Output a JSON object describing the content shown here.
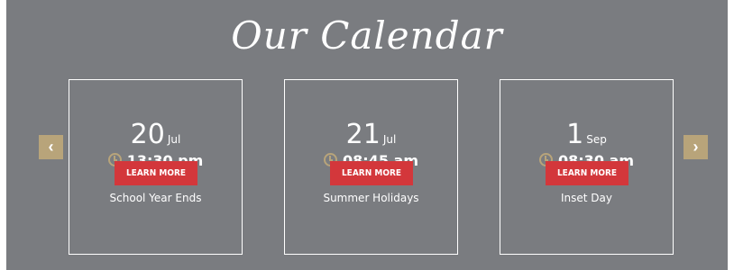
{
  "section": {
    "title": "Our Calendar"
  },
  "navigation": {
    "prev_icon": "chevron-left-icon",
    "next_icon": "chevron-right-icon",
    "prev_glyph": "‹",
    "next_glyph": "›"
  },
  "events": [
    {
      "day": "20",
      "month": "Jul",
      "time": "13:30 pm",
      "title": "School Year Ends",
      "button_label": "LEARN MORE"
    },
    {
      "day": "21",
      "month": "Jul",
      "time": "08:45 am",
      "title": "Summer Holidays",
      "button_label": "LEARN MORE"
    },
    {
      "day": "1",
      "month": "Sep",
      "time": "08:30 am",
      "title": "Inset Day",
      "button_label": "LEARN MORE"
    }
  ],
  "colors": {
    "background": "#7a7c80",
    "accent": "#b8a47a",
    "button": "#d3373b",
    "text": "#ffffff"
  }
}
